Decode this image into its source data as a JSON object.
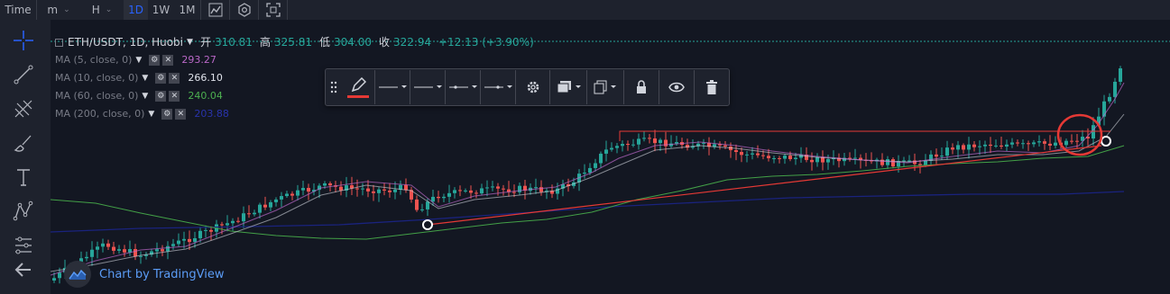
{
  "toolbar": {
    "time_label": "Time",
    "minute_label": "m",
    "hour_label": "H",
    "day_label": "1D",
    "week_label": "1W",
    "month_label": "1M",
    "icons": [
      "chart-type-icon",
      "indicators-icon",
      "fullscreen-icon"
    ]
  },
  "left_tools": [
    "crosshair-icon",
    "trend-line-icon",
    "pitchfork-icon",
    "brush-icon",
    "text-icon",
    "pattern-icon",
    "prediction-icon",
    "back-arrow-icon"
  ],
  "legend": {
    "symbol": "ETH/USDT, 1D, Huobi",
    "open_label": "开",
    "open": "310.81",
    "high_label": "高",
    "high": "325.81",
    "low_label": "低",
    "low": "304.00",
    "close_label": "收",
    "close": "322.94",
    "change": "+12.13 (+3.90%)",
    "studies": [
      {
        "name": "MA (5, close, 0)",
        "value": "293.27",
        "color": "#ba68c8"
      },
      {
        "name": "MA (10, close, 0)",
        "value": "266.10",
        "color": "#e0e3eb"
      },
      {
        "name": "MA (60, close, 0)",
        "value": "240.04",
        "color": "#4caf50"
      },
      {
        "name": "MA (200, close, 0)",
        "value": "203.88",
        "color": "#2933ab"
      }
    ]
  },
  "drawing_toolbar": [
    "pencil-icon",
    "line-color-dropdown",
    "line-width-dropdown",
    "line-style-dropdown",
    "line-ends-dropdown",
    "settings-icon",
    "template-icon",
    "clone-icon",
    "lock-icon",
    "visibility-icon",
    "trash-icon"
  ],
  "watermark": "Chart by TradingView",
  "colors": {
    "up": "#26a69a",
    "down": "#ef5350",
    "background": "#131722",
    "panel": "#1e222d",
    "accent": "#2962ff",
    "drawing": "#e53935"
  }
}
